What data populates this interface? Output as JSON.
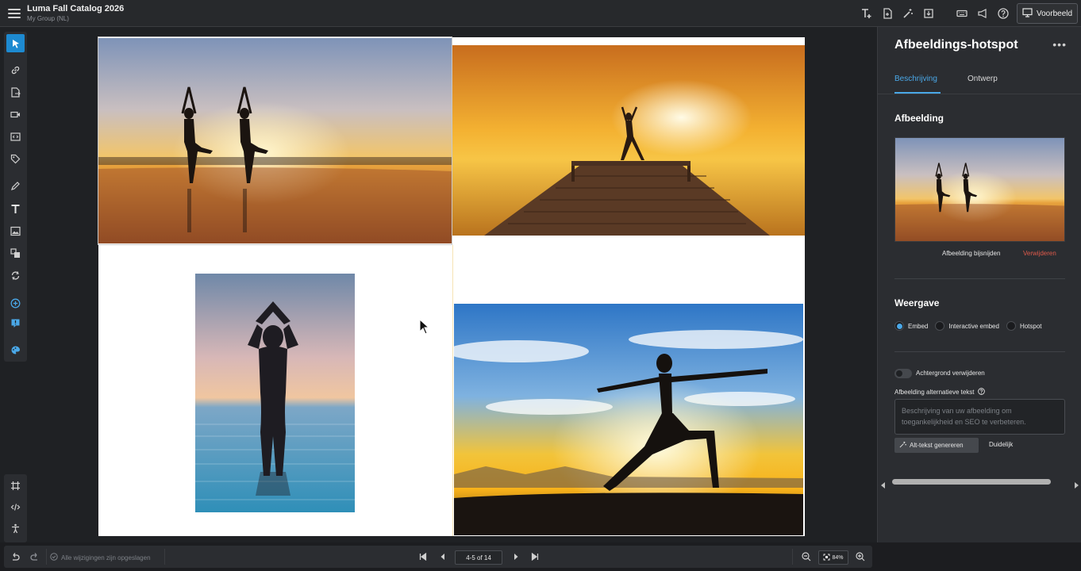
{
  "header": {
    "title": "Luma Fall Catalog 2026",
    "subtitle": "My Group (NL)",
    "preview_label": "Voorbeeld"
  },
  "panel": {
    "title": "Afbeeldings-hotspot",
    "more_label": "•••",
    "tabs": [
      {
        "label": "Beschrijving",
        "active": true
      },
      {
        "label": "Ontwerp",
        "active": false
      }
    ],
    "image_section": {
      "title": "Afbeelding",
      "crop_label": "Afbeelding bijsnijden",
      "remove_label": "Verwijderen"
    },
    "display_section": {
      "title": "Weergave",
      "options": [
        {
          "label": "Embed",
          "selected": true
        },
        {
          "label": "Interactive embed",
          "selected": false
        },
        {
          "label": "Hotspot",
          "selected": false
        }
      ]
    },
    "remove_bg_label": "Achtergrond verwijderen",
    "alt_text": {
      "label": "Afbeelding alternatieve tekst",
      "placeholder": "Beschrijving van uw afbeelding om toegankelijkheid en SEO te verbeteren.",
      "generate_label": "Alt-tekst genereren",
      "clear_label": "Duidelijk"
    }
  },
  "footer": {
    "saved_status": "Alle wijzigingen zijn opgeslagen",
    "page_indicator": "4-5 of 14",
    "zoom_level": "84%"
  },
  "colors": {
    "accent": "#1d8ad1",
    "link_blue": "#4aa8e8",
    "danger": "#e05a4b"
  }
}
